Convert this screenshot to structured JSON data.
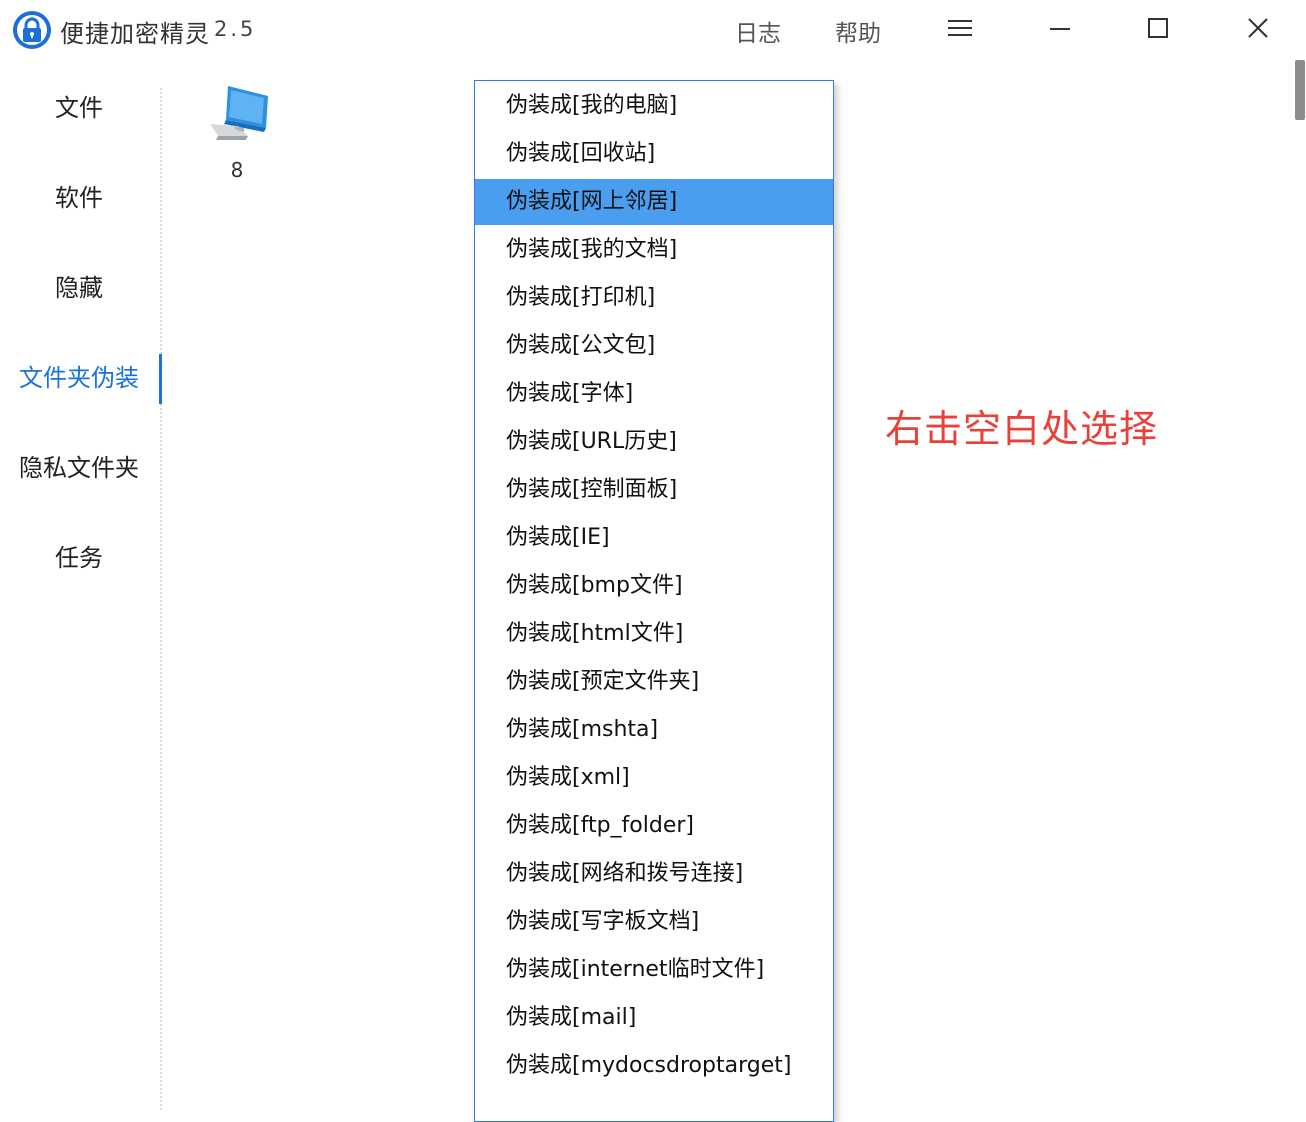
{
  "app": {
    "title": "便捷加密精灵",
    "version": "2.5"
  },
  "top_links": {
    "log": "日志",
    "help": "帮助"
  },
  "sidebar": {
    "items": [
      {
        "label": "文件",
        "active": false
      },
      {
        "label": "软件",
        "active": false
      },
      {
        "label": "隐藏",
        "active": false
      },
      {
        "label": "文件夹伪装",
        "active": true
      },
      {
        "label": "隐私文件夹",
        "active": false
      },
      {
        "label": "任务",
        "active": false
      }
    ]
  },
  "desktop_item": {
    "label": "8",
    "icon": "computer-icon"
  },
  "context_menu": {
    "items": [
      "伪装成[我的电脑]",
      "伪装成[回收站]",
      "伪装成[网上邻居]",
      "伪装成[我的文档]",
      "伪装成[打印机]",
      "伪装成[公文包]",
      "伪装成[字体]",
      "伪装成[URL历史]",
      "伪装成[控制面板]",
      "伪装成[IE]",
      "伪装成[bmp文件]",
      "伪装成[html文件]",
      "伪装成[预定文件夹]",
      "伪装成[mshta]",
      "伪装成[xml]",
      "伪装成[ftp_folder]",
      "伪装成[网络和拨号连接]",
      "伪装成[写字板文档]",
      "伪装成[internet临时文件]",
      "伪装成[mail]",
      "伪装成[mydocsdroptarget]"
    ],
    "highlighted_index": 2
  },
  "annotation": {
    "text": "右击空白处选择"
  },
  "colors": {
    "accent": "#1a73d9",
    "highlight": "#4a9ef0",
    "annotation": "#e8413a"
  }
}
